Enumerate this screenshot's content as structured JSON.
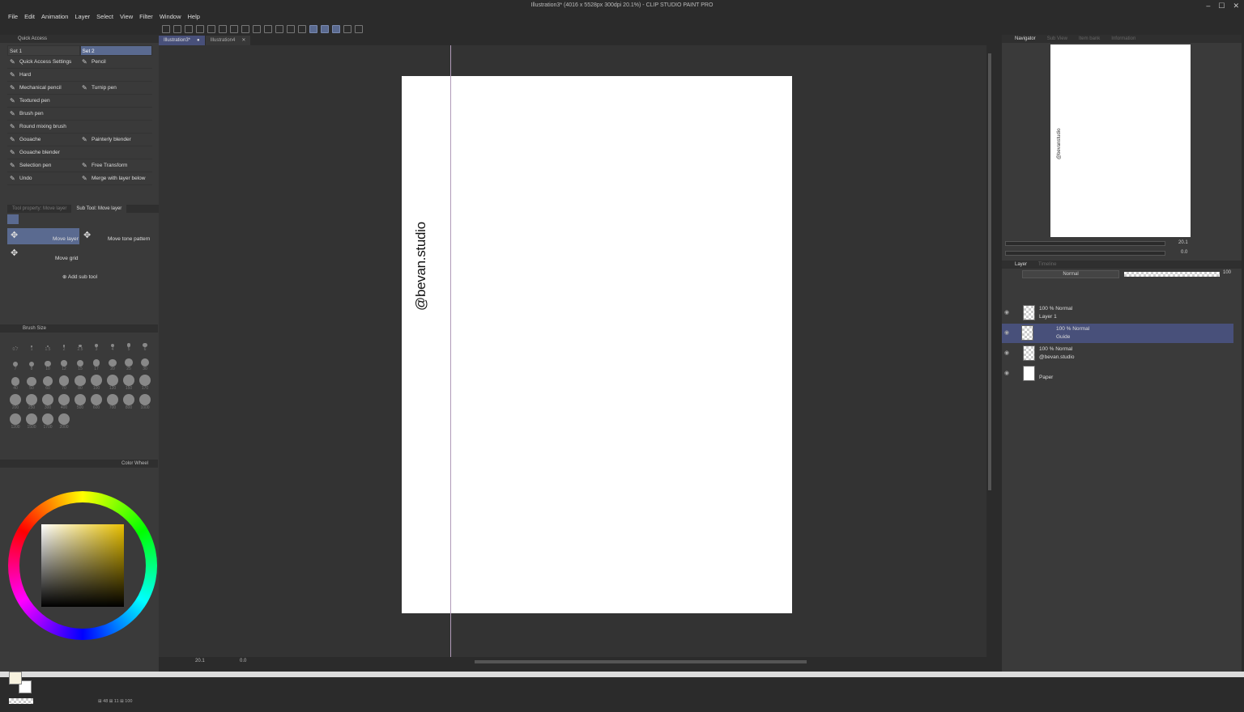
{
  "window": {
    "title": "Illustration3* (4016 x 5528px 300dpi 20.1%)  - CLIP STUDIO PAINT PRO",
    "controls": [
      "–",
      "☐",
      "✕"
    ]
  },
  "menu": [
    "File",
    "Edit",
    "Animation",
    "Layer",
    "Select",
    "View",
    "Filter",
    "Window",
    "Help"
  ],
  "document_tabs": [
    {
      "label": "Illustration3*",
      "close": "●",
      "active": true
    },
    {
      "label": "Illustration4",
      "close": "✕",
      "active": false
    }
  ],
  "quick_access": {
    "title": "Quick Access",
    "sets": [
      "Set 1",
      "Set 2"
    ],
    "items": [
      {
        "label": "Quick Access Settings",
        "icon": "settings-icon"
      },
      {
        "label": "Pencil",
        "icon": "pencil-icon"
      },
      {
        "label": "Hard",
        "icon": "eraser-icon"
      },
      {
        "label": "",
        "icon": ""
      },
      {
        "label": "Mechanical pencil",
        "icon": "pencil-icon"
      },
      {
        "label": "Turnip pen",
        "icon": "pen-icon"
      },
      {
        "label": "Textured pen",
        "icon": "pen-icon"
      },
      {
        "label": "",
        "icon": ""
      },
      {
        "label": "Brush pen",
        "icon": "brush-icon"
      },
      {
        "label": "",
        "icon": ""
      },
      {
        "label": "Round mixing brush",
        "icon": "brush-icon"
      },
      {
        "label": "",
        "icon": ""
      },
      {
        "label": "Gouache",
        "icon": "brush-icon"
      },
      {
        "label": "Painterly blender",
        "icon": "blender-icon"
      },
      {
        "label": "Gouache blender",
        "icon": "brush-icon"
      },
      {
        "label": "",
        "icon": ""
      },
      {
        "label": "Selection pen",
        "icon": "pen-icon"
      },
      {
        "label": "Free Transform",
        "icon": "transform-icon"
      },
      {
        "label": "Undo",
        "icon": "undo-icon"
      },
      {
        "label": "Merge with layer below",
        "icon": "merge-icon"
      }
    ]
  },
  "subtool": {
    "tabs": [
      "Tool property: Move layer",
      "Sub Tool: Move layer"
    ],
    "items": [
      "Move layer",
      "Move tone pattern",
      "Move grid"
    ],
    "add_label": "Add sub tool"
  },
  "brush_size": {
    "title": "Brush Size",
    "sizes": [
      "0.7",
      "1",
      "1.5",
      "2",
      "2.5",
      "3",
      "4",
      "5",
      "6",
      "7",
      "8",
      "10",
      "12",
      "15",
      "17",
      "20",
      "25",
      "30",
      "40",
      "50",
      "60",
      "70",
      "80",
      "100",
      "120",
      "150",
      "170",
      "200",
      "250",
      "300",
      "400",
      "500",
      "600",
      "700",
      "800",
      "1000",
      "1200",
      "1500",
      "1700",
      "2000"
    ]
  },
  "color": {
    "tab_label": "Color Wheel",
    "primary": "#f7f2de",
    "secondary": "#ffffff",
    "status": "⊞ 48  ⊞ 11  ⊞ 100"
  },
  "canvas": {
    "watermark": "@bevan.studio",
    "zoom": "20.1",
    "rotation": "0.0"
  },
  "navigator": {
    "tabs": [
      "Navigator",
      "Sub View",
      "Item bank",
      "Information"
    ],
    "zoom": "20.1",
    "rotation": "0.0",
    "watermark": "@bevanstudio"
  },
  "layers": {
    "tabs": [
      "Layer",
      "Timeline"
    ],
    "blend_mode": "Normal",
    "opacity": "100",
    "rows": [
      {
        "mode": "100 % Normal",
        "name": "Layer 1",
        "selected": false,
        "thumb": "checker"
      },
      {
        "mode": "100 % Normal",
        "name": "Guide",
        "selected": true,
        "thumb": "checker"
      },
      {
        "mode": "100 % Normal",
        "name": "@bevan.studio",
        "selected": false,
        "thumb": "checker"
      },
      {
        "mode": "",
        "name": "Paper",
        "selected": false,
        "thumb": "white"
      }
    ]
  }
}
